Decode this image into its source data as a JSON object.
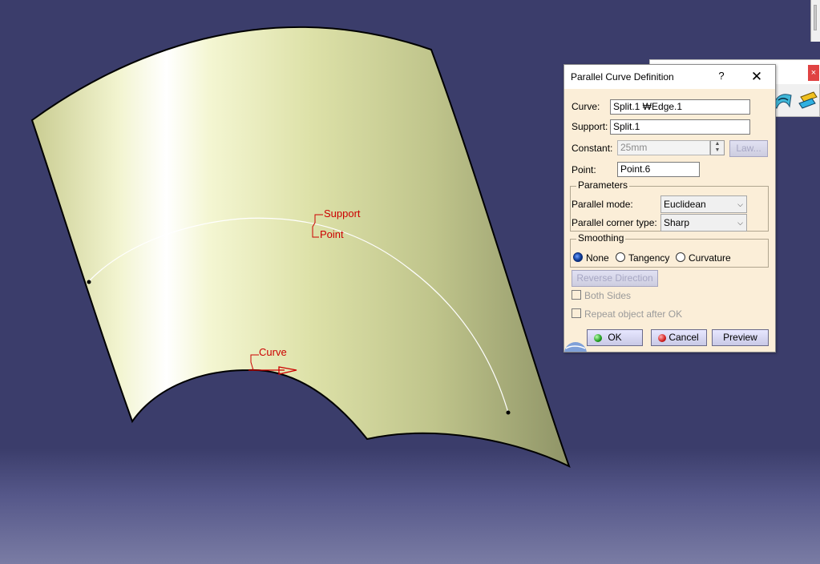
{
  "viewport": {
    "annotations": {
      "support": "Support",
      "point": "Point",
      "curve": "Curve"
    }
  },
  "toolbar_window": {
    "close_glyph": "×",
    "icons": [
      "surface-icon",
      "layers-icon"
    ]
  },
  "dialog": {
    "title": "Parallel Curve Definition",
    "help_glyph": "?",
    "close_glyph": "✕",
    "curve": {
      "label": "Curve:",
      "value": "Split.1 ₩Edge.1"
    },
    "support": {
      "label": "Support:",
      "value": "Split.1"
    },
    "constant": {
      "label": "Constant:",
      "value": "25mm",
      "law_button": "Law..."
    },
    "point": {
      "label": "Point:",
      "value": "Point.6"
    },
    "parameters": {
      "title": "Parameters",
      "mode_label": "Parallel mode:",
      "mode_value": "Euclidean",
      "corner_label": "Parallel corner type:",
      "corner_value": "Sharp"
    },
    "smoothing": {
      "title": "Smoothing",
      "options": [
        "None",
        "Tangency",
        "Curvature"
      ],
      "selected": "None"
    },
    "reverse_direction": "Reverse Direction",
    "both_sides": "Both Sides",
    "repeat_object": "Repeat object after OK",
    "ok": "OK",
    "cancel": "Cancel",
    "preview": "Preview"
  },
  "colors": {
    "background": "#3b3d6b",
    "surface": "#d8dca6",
    "annotation": "#cc0000",
    "dialog_bg": "#fbeed8"
  }
}
